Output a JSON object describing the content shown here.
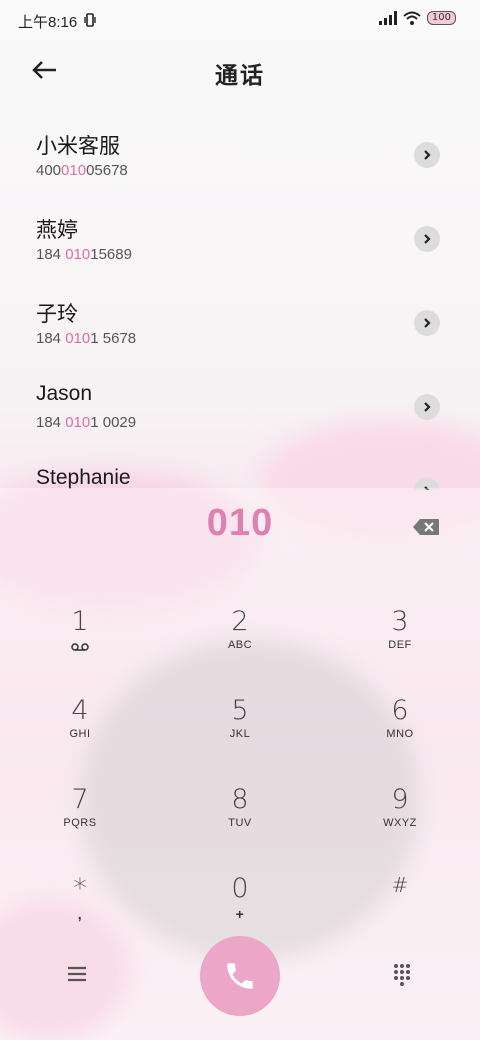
{
  "status_bar": {
    "time": "上午8:16",
    "battery": "100"
  },
  "header": {
    "title": "通话"
  },
  "results": [
    {
      "name": "小米客服",
      "number_parts": [
        "400",
        "010",
        "05678"
      ]
    },
    {
      "name": "燕婷",
      "number_parts": [
        "184 ",
        "010",
        "15689"
      ]
    },
    {
      "name": "子玲",
      "number_parts": [
        "184 ",
        "010",
        "1 5678"
      ]
    },
    {
      "name": "Jason",
      "number_parts": [
        "184 ",
        "010",
        "1 0029"
      ]
    },
    {
      "name": "Stephanie",
      "number_parts": [
        "",
        "",
        ""
      ]
    }
  ],
  "dialer": {
    "entered": "010",
    "keys": [
      {
        "digit": "1",
        "letters": ""
      },
      {
        "digit": "2",
        "letters": "ABC"
      },
      {
        "digit": "3",
        "letters": "DEF"
      },
      {
        "digit": "4",
        "letters": "GHI"
      },
      {
        "digit": "5",
        "letters": "JKL"
      },
      {
        "digit": "6",
        "letters": "MNO"
      },
      {
        "digit": "7",
        "letters": "PQRS"
      },
      {
        "digit": "8",
        "letters": "TUV"
      },
      {
        "digit": "9",
        "letters": "WXYZ"
      },
      {
        "digit": "*",
        "letters": ","
      },
      {
        "digit": "0",
        "letters": "+"
      },
      {
        "digit": "#",
        "letters": ""
      }
    ]
  },
  "colors": {
    "accent": "#e07fb1",
    "call_button": "#eba6c9"
  }
}
